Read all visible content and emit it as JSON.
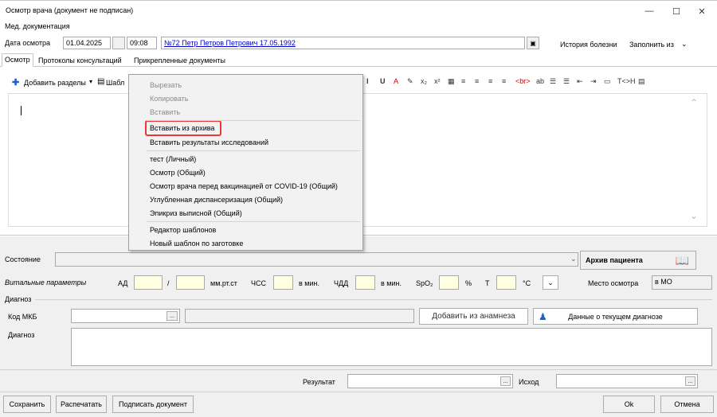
{
  "window": {
    "title": "Осмотр врача (документ не подписан)",
    "minimize": "—",
    "maximize": "☐",
    "close": "✕"
  },
  "menu": {
    "med_docs": "Мед. документация"
  },
  "top": {
    "date_label": "Дата осмотра",
    "date_value": "01.04.2025",
    "time_value": "09:08",
    "patient_link": "№72 Петр Петров Петрович 17.05.1992",
    "history_btn": "История болезни",
    "fill_from": "Заполнить из"
  },
  "tabs": [
    "Осмотр",
    "Протоколы консультаций",
    "Прикрепленные документы"
  ],
  "toolbar": {
    "add_sections": "Добавить разделы",
    "templates": "Шабл",
    "right_icons": [
      "I",
      "U",
      "A",
      "✎",
      "x₂",
      "x²",
      "▦",
      "≡",
      "≡",
      "≡",
      "≡",
      "<br>",
      "ab",
      "☰",
      "☰",
      "⇤",
      "⇥",
      "▭",
      "T<>H",
      "▤"
    ]
  },
  "context_menu": {
    "items": [
      {
        "label": "Вырезать",
        "disabled": true
      },
      {
        "label": "Копировать",
        "disabled": true
      },
      {
        "label": "Вставить",
        "disabled": true
      },
      {
        "label": "Вставить из архива",
        "disabled": false
      },
      {
        "label": "Вставить результаты исследований",
        "disabled": false
      },
      {
        "label": "тест (Личный)",
        "disabled": false
      },
      {
        "label": "Осмотр (Общий)",
        "disabled": false
      },
      {
        "label": "Осмотр врача перед вакцинацией от COVID-19 (Общий)",
        "disabled": false
      },
      {
        "label": "Углубленная диспансеризация (Общий)",
        "disabled": false
      },
      {
        "label": "Эпикриз выписной (Общий)",
        "disabled": false
      },
      {
        "label": "Редактор шаблонов",
        "disabled": false
      },
      {
        "label": "Новый шаблон по заготовке",
        "disabled": false
      }
    ]
  },
  "state": {
    "label": "Состояние",
    "archive_btn": "Архив пациента"
  },
  "vitals": {
    "label": "Витальные параметры",
    "ad": "АД",
    "slash": "/",
    "mmhg": "мм.рт.ст",
    "hr": "ЧСС",
    "per_min1": "в мин.",
    "rr": "ЧДД",
    "per_min2": "в мин.",
    "spo2": "SpO₂",
    "pct": "%",
    "t": "Т",
    "celsius": "°С",
    "place_label": "Место осмотра",
    "place_value": "в МО"
  },
  "diagnosis": {
    "group": "Диагноз",
    "mkb_label": "Код МКБ",
    "from_anamnesis": "Добавить из анамнеза",
    "current_dx": "Данные о текущем диагнозе",
    "dx_label": "Диагноз"
  },
  "result": {
    "result_label": "Результат",
    "outcome_label": "Исход"
  },
  "footer": {
    "save": "Сохранить",
    "print": "Распечатать",
    "sign": "Подписать документ",
    "ok": "Ok",
    "cancel": "Отмена"
  },
  "colors": {
    "link": "#0000cc",
    "highlight": "#e53935",
    "yellow": "#ffffe1"
  }
}
